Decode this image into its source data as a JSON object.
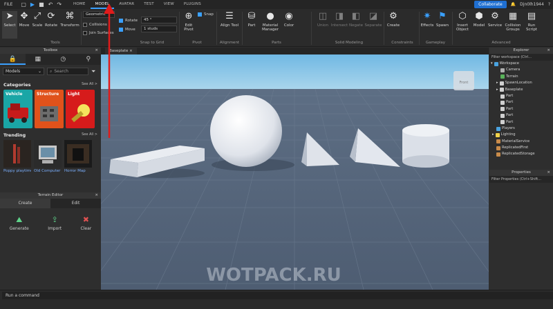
{
  "menubar": {
    "file": "FILE",
    "tabs": [
      "HOME",
      "MODEL",
      "AVATAR",
      "TEST",
      "VIEW",
      "PLUGINS"
    ],
    "active_tab": "MODEL",
    "collaborate": "Collaborate",
    "user": "Djn0lh1944"
  },
  "ribbon": {
    "tools": [
      "Select",
      "Move",
      "Scale",
      "Rotate",
      "Transform"
    ],
    "tools_group": "Tools",
    "geometric": "Geometric",
    "collisions": "Collisions",
    "join_surfaces": "Join Surfaces",
    "rotate_label": "Rotate",
    "rotate_value": "45 °",
    "move_label": "Move",
    "move_value": "1 studs",
    "snap_group": "Snap to Grid",
    "edit_pivot": "Edit Pivot",
    "snap": "Snap",
    "pivot_group": "Pivot",
    "align_tool": "Align Tool",
    "alignment_group": "Alignment",
    "part": "Part",
    "material_manager": "Material Manager",
    "color": "Color",
    "parts_group": "Parts",
    "solid_modeling": [
      "Union",
      "Intersect",
      "Negate",
      "Separate"
    ],
    "solid_group": "Solid Modeling",
    "create": "Create",
    "constraints_group": "Constraints",
    "effects": "Effects",
    "spawn": "Spawn",
    "gameplay_group": "Gameplay",
    "advanced": [
      "Insert Object",
      "Model",
      "Service",
      "Collision Groups",
      "Run Script"
    ],
    "advanced_group": "Advanced"
  },
  "toolbox": {
    "title": "Toolbox",
    "filter": "Models",
    "search_placeholder": "Search",
    "categories_title": "Categories",
    "see_all": "See All >",
    "categories": [
      "Vehicle",
      "Structure",
      "Light"
    ],
    "trending_title": "Trending",
    "trending": [
      "Poppy playtime 3...",
      "Old Computer",
      "Horror Map"
    ]
  },
  "terrain": {
    "title": "Terrain Editor",
    "tabs": [
      "Create",
      "Edit"
    ],
    "buttons": [
      "Generate",
      "Import",
      "Clear"
    ]
  },
  "viewport": {
    "tab": "Baseplate",
    "watermark": "WOTPACK.RU",
    "view_cube_label": "Front"
  },
  "explorer": {
    "title": "Explorer",
    "filter_placeholder": "Filter workspace (Ctrl...",
    "items": [
      "Workspace",
      "Camera",
      "Terrain",
      "SpawnLocation",
      "Baseplate",
      "Part",
      "Part",
      "Part",
      "Part",
      "Part",
      "Players",
      "Lighting",
      "MaterialService",
      "ReplicatedFirst",
      "ReplicatedStorage"
    ]
  },
  "properties": {
    "title": "Properties",
    "filter_placeholder": "Filter Properties (Ctrl+Shift..."
  },
  "command_bar": {
    "placeholder": "Run a command"
  },
  "colors": {
    "accent": "#3aa0ff",
    "annotation_arrow": "#e01b1b"
  }
}
